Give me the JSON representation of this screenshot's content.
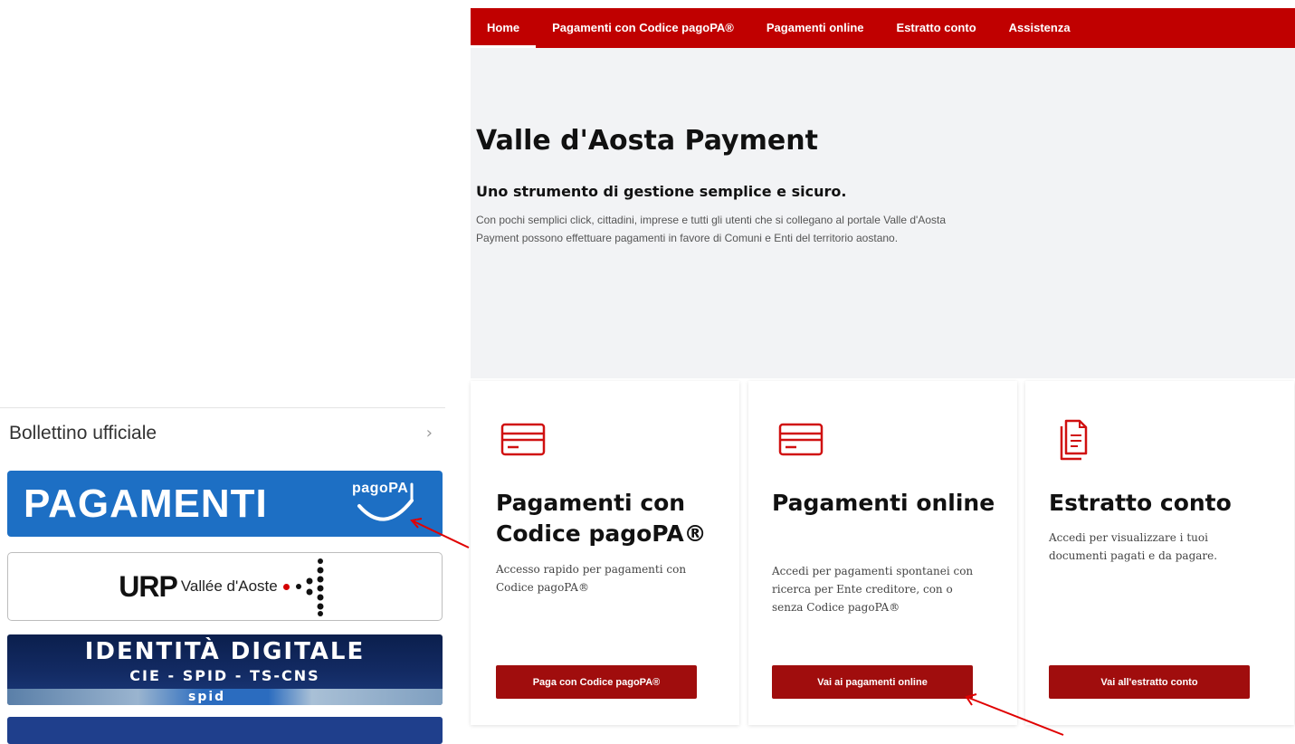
{
  "sidebar": {
    "bollettino_label": "Bollettino ufficiale",
    "pagamenti_banner": {
      "text": "PAGAMENTI",
      "logo_text": "pagoPA",
      "color": "#1d6fc4"
    },
    "urp_banner": {
      "brand": "URP",
      "subtitle": "Vallée d'Aoste"
    },
    "identita_banner": {
      "title": "IDENTITÀ DIGITALE",
      "subtitle": "CIE - SPID - TS-CNS",
      "spid": "spid"
    }
  },
  "nav": {
    "color": "#c00000",
    "items": [
      {
        "label": "Home",
        "active": true
      },
      {
        "label": "Pagamenti con Codice pagoPA®"
      },
      {
        "label": "Pagamenti online"
      },
      {
        "label": "Estratto conto"
      },
      {
        "label": "Assistenza"
      }
    ]
  },
  "hero": {
    "title": "Valle d'Aosta Payment",
    "subtitle": "Uno strumento di gestione semplice e sicuro.",
    "description": "Con pochi semplici click, cittadini, imprese e tutti gli utenti che si collegano al portale Valle d'Aosta Payment possono effettuare pagamenti in favore di Comuni e Enti del territorio aostano."
  },
  "cards": [
    {
      "icon": "credit-card-icon",
      "title": "Pagamenti con Codice pagoPA®",
      "text": "Accesso rapido per pagamenti con Codice pagoPA®",
      "button": "Paga con Codice pagoPA®"
    },
    {
      "icon": "credit-card-icon",
      "title": "Pagamenti online",
      "text": "Accedi per pagamenti spontanei con ricerca per Ente creditore, con o senza Codice pagoPA®",
      "button": "Vai ai pagamenti online"
    },
    {
      "icon": "document-icon",
      "title": "Estratto conto",
      "text": "Accedi per visualizzare i tuoi documenti pagati e da pagare.",
      "button": "Vai all'estratto conto"
    }
  ],
  "colors": {
    "accent": "#c00000",
    "button": "#a00d0d",
    "annotation_arrow": "#e00000"
  }
}
